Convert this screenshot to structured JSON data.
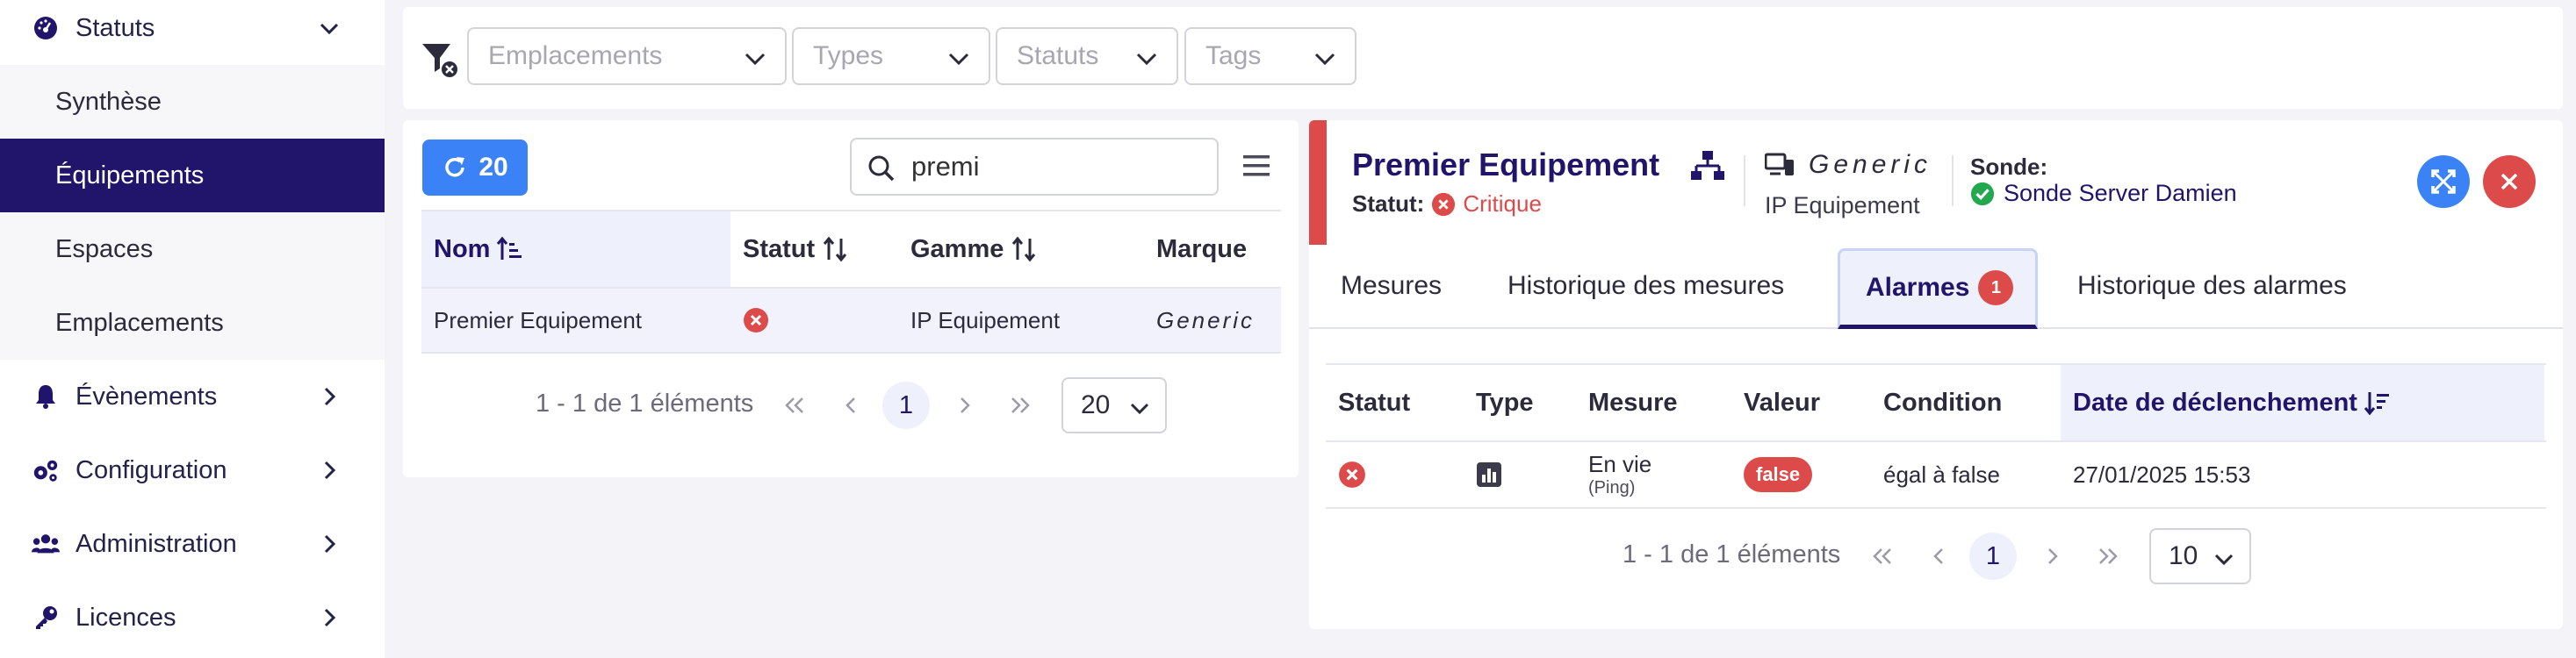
{
  "sidebar": {
    "items": [
      {
        "label": "Statuts",
        "icon": "gauge-icon",
        "expanded": true
      },
      {
        "label": "Synthèse"
      },
      {
        "label": "Équipements",
        "active": true
      },
      {
        "label": "Espaces"
      },
      {
        "label": "Emplacements"
      },
      {
        "label": "Évènements",
        "icon": "bell-icon"
      },
      {
        "label": "Configuration",
        "icon": "gears-icon"
      },
      {
        "label": "Administration",
        "icon": "users-icon"
      },
      {
        "label": "Licences",
        "icon": "key-icon"
      }
    ]
  },
  "filters": {
    "emplacements_placeholder": "Emplacements",
    "types_placeholder": "Types",
    "statuts_placeholder": "Statuts",
    "tags_placeholder": "Tags"
  },
  "list": {
    "refresh_count": "20",
    "search_value": "premi",
    "columns": [
      "Nom",
      "Statut",
      "Gamme",
      "Marque"
    ],
    "rows": [
      {
        "nom": "Premier Equipement",
        "statut": "critique",
        "gamme": "IP Equipement",
        "marque": "Generic"
      }
    ],
    "pagination": {
      "summary": "1 - 1 de 1 éléments",
      "current_page": "1",
      "page_size": "20"
    }
  },
  "detail": {
    "title": "Premier Equipement",
    "status_label": "Statut:",
    "status_value": "Critique",
    "brand": "Generic",
    "range": "IP Equipement",
    "probe_label": "Sonde:",
    "probe_value": "Sonde Server Damien",
    "tabs": [
      {
        "label": "Mesures"
      },
      {
        "label": "Historique des mesures"
      },
      {
        "label": "Alarmes",
        "badge": "1",
        "active": true
      },
      {
        "label": "Historique des alarmes"
      }
    ],
    "alarms": {
      "columns": [
        "Statut",
        "Type",
        "Mesure",
        "Valeur",
        "Condition",
        "Date de déclenchement"
      ],
      "rows": [
        {
          "mesure": "En vie",
          "mesure_sub": "(Ping)",
          "valeur": "false",
          "condition": "égal à false",
          "date": "27/01/2025 15:53"
        }
      ],
      "pagination": {
        "summary": "1 - 1 de 1 éléments",
        "current_page": "1",
        "page_size": "10"
      }
    }
  },
  "colors": {
    "primary": "#21146b",
    "accent_blue": "#3b82f6",
    "danger": "#dc4a4a",
    "success": "#22a94f"
  }
}
